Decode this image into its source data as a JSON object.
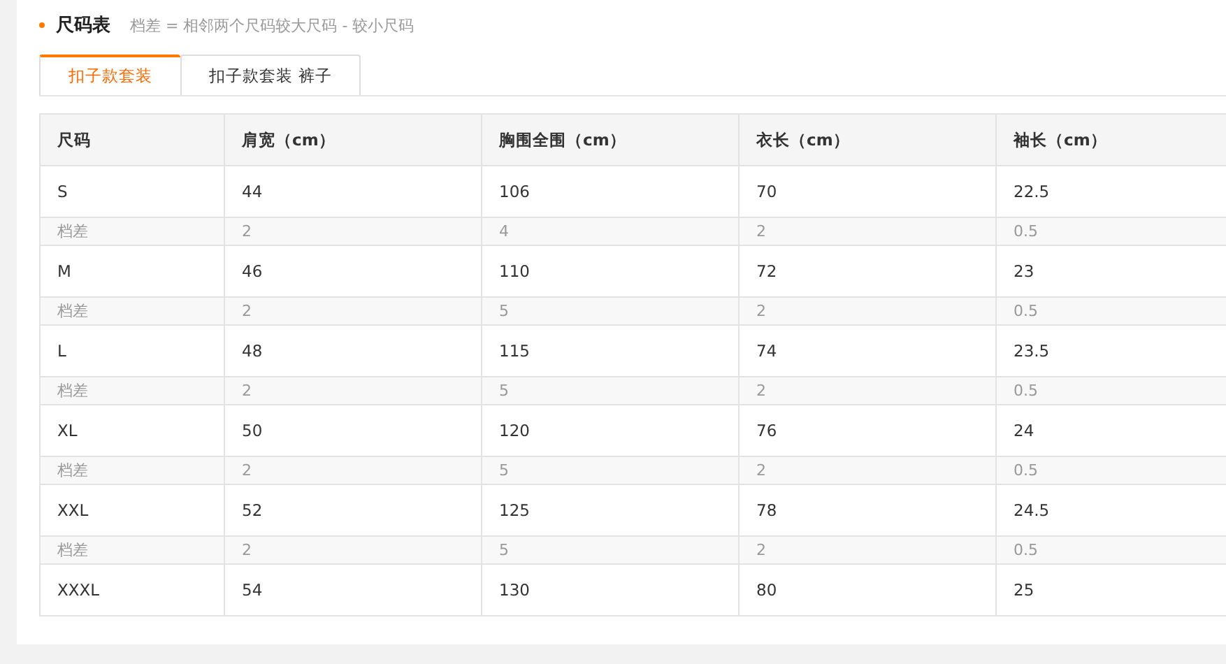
{
  "section": {
    "title": "尺码表",
    "note": "档差 = 相邻两个尺码较大尺码 - 较小尺码"
  },
  "tabs": [
    {
      "label": "扣子款套装",
      "selected": true
    },
    {
      "label": "扣子款套装 裤子",
      "selected": false
    }
  ],
  "table": {
    "columns": [
      "尺码",
      "肩宽（cm）",
      "胸围全围（cm）",
      "衣长（cm）",
      "袖长（cm）"
    ],
    "rows": [
      {
        "kind": "size",
        "cells": [
          "S",
          "44",
          "106",
          "70",
          "22.5"
        ]
      },
      {
        "kind": "diff",
        "cells": [
          "档差",
          "2",
          "4",
          "2",
          "0.5"
        ]
      },
      {
        "kind": "size",
        "cells": [
          "M",
          "46",
          "110",
          "72",
          "23"
        ]
      },
      {
        "kind": "diff",
        "cells": [
          "档差",
          "2",
          "5",
          "2",
          "0.5"
        ]
      },
      {
        "kind": "size",
        "cells": [
          "L",
          "48",
          "115",
          "74",
          "23.5"
        ]
      },
      {
        "kind": "diff",
        "cells": [
          "档差",
          "2",
          "5",
          "2",
          "0.5"
        ]
      },
      {
        "kind": "size",
        "cells": [
          "XL",
          "50",
          "120",
          "76",
          "24"
        ]
      },
      {
        "kind": "diff",
        "cells": [
          "档差",
          "2",
          "5",
          "2",
          "0.5"
        ]
      },
      {
        "kind": "size",
        "cells": [
          "XXL",
          "52",
          "125",
          "78",
          "24.5"
        ]
      },
      {
        "kind": "diff",
        "cells": [
          "档差",
          "2",
          "5",
          "2",
          "0.5"
        ]
      },
      {
        "kind": "size",
        "cells": [
          "XXXL",
          "54",
          "130",
          "80",
          "25"
        ]
      }
    ]
  }
}
